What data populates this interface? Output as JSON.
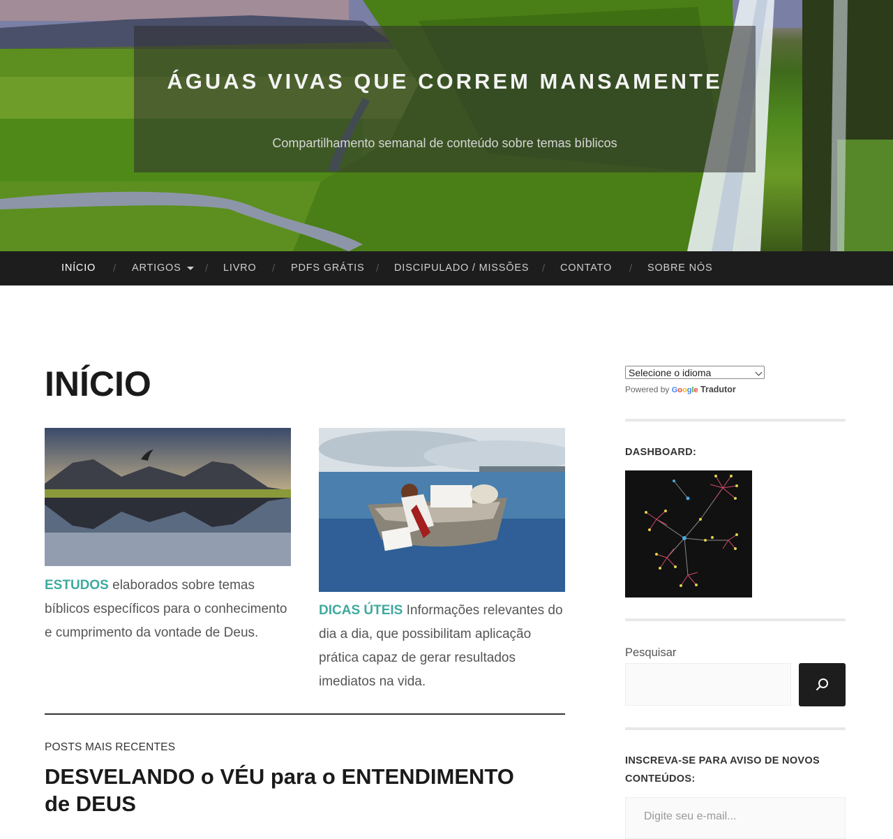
{
  "header": {
    "site_title": "ÁGUAS VIVAS QUE CORREM MANSAMENTE",
    "site_description": "Compartilhamento semanal de conteúdo sobre temas bíblicos"
  },
  "nav": {
    "items": [
      {
        "label": "INÍCIO",
        "active": true
      },
      {
        "label": "ARTIGOS",
        "has_dropdown": true
      },
      {
        "label": "LIVRO"
      },
      {
        "label": "PDFS GRÁTIS"
      },
      {
        "label": "DISCIPULADO / MISSÕES"
      },
      {
        "label": "CONTATO"
      },
      {
        "label": "SOBRE NÓS"
      }
    ],
    "separator": "/"
  },
  "main": {
    "page_title": "INÍCIO",
    "cards": [
      {
        "highlight": "ESTUDOS",
        "lines": [
          " elaborados sobre temas",
          "bíblicos específicos para o conhecimento",
          "e cumprimento da vontade de Deus."
        ]
      },
      {
        "highlight": "DICAS ÚTEIS",
        "lines": [
          " Informações relevantes do",
          "dia a dia, que possibilitam aplicação",
          "prática capaz de gerar resultados",
          "imediatos na vida."
        ]
      }
    ],
    "posts_label": "POSTS MAIS RECENTES",
    "latest_post_title": "DESVELANDO o VÉU para o ENTENDIMENTO de DEUS"
  },
  "sidebar": {
    "language_select": "Selecione o idioma",
    "powered_by": "Powered by",
    "google": "Google",
    "translator": "Tradutor",
    "dashboard_title": "DASHBOARD:",
    "search_label": "Pesquisar",
    "subscribe_title": "INSCREVA-SE PARA AVISO DE NOVOS CONTEÚDOS:",
    "email_placeholder": "Digite seu e-mail..."
  },
  "colors": {
    "accent": "#3fa99f",
    "nav_bg": "#1d1d1d"
  }
}
